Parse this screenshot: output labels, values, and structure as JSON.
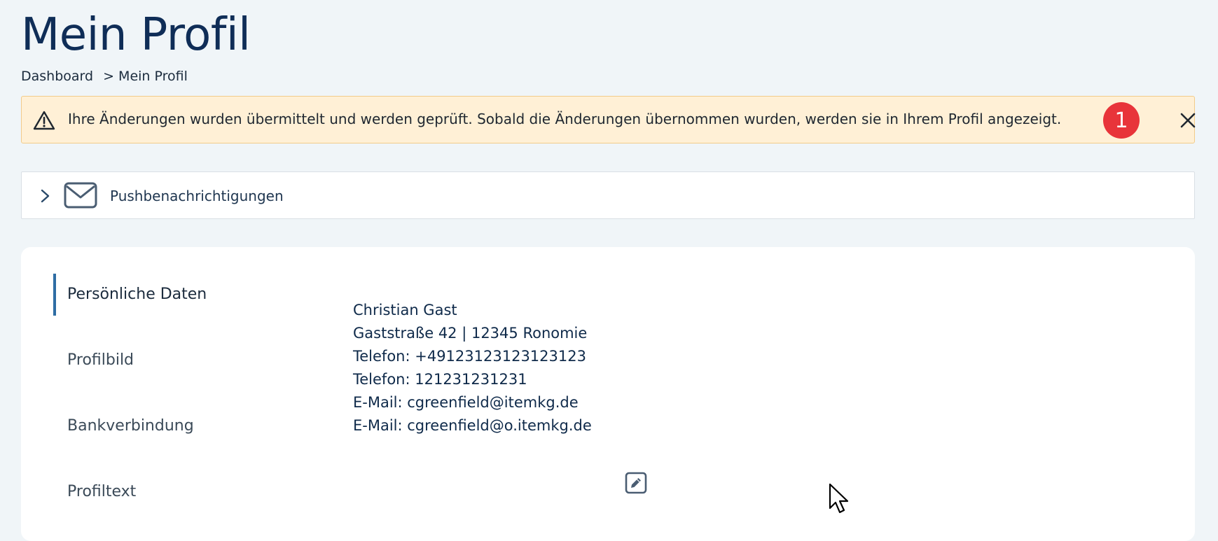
{
  "header": {
    "title": "Mein Profil"
  },
  "breadcrumb": {
    "items": [
      {
        "label": "Dashboard"
      },
      {
        "label": "> Mein Profil"
      }
    ]
  },
  "alert": {
    "icon": "warning-icon",
    "message": "Ihre Änderungen wurden übermittelt und werden geprüft. Sobald die Änderungen übernommen wurden, werden sie in Ihrem Profil angezeigt.",
    "badge_count": "1",
    "badge_color": "#e8343a",
    "background": "#fff0d6",
    "close_icon": "close-icon"
  },
  "accordion": {
    "chevron_icon": "chevron-right-icon",
    "mail_icon": "envelope-icon",
    "label": "Pushbenachrichtigungen"
  },
  "sidebar": {
    "accent": "#2e6da4",
    "items": [
      {
        "label": "Persönliche Daten",
        "active": true
      },
      {
        "label": "Profilbild",
        "active": false
      },
      {
        "label": "Bankverbindung",
        "active": false
      },
      {
        "label": "Profiltext",
        "active": false
      }
    ]
  },
  "personal": {
    "lines": [
      "Christian Gast",
      "Gaststraße 42 | 12345 Ronomie",
      "Telefon: +4912312312312312​3",
      "Telefon: 121231231231",
      "E-Mail: cgreenfield@itemkg.de",
      "E-Mail: cgreenfield@o.itemkg.de"
    ],
    "edit_icon": "edit-icon"
  }
}
